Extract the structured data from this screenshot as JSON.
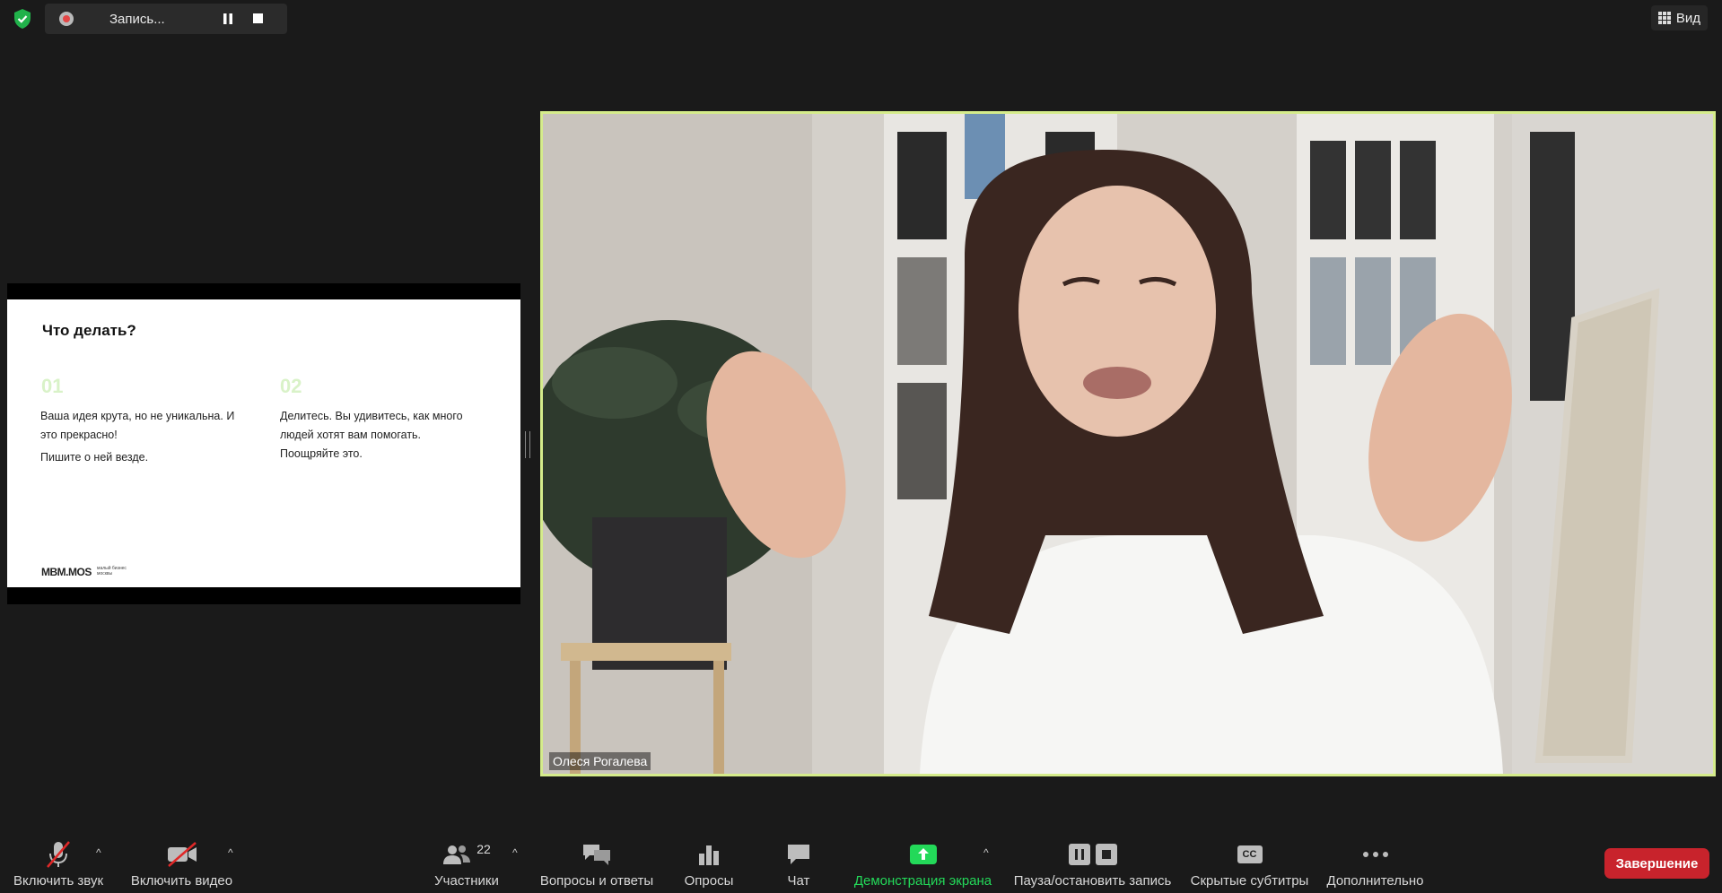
{
  "recording": {
    "label": "Запись..."
  },
  "view_button": {
    "label": "Вид"
  },
  "slide": {
    "title": "Что делать?",
    "col1": {
      "num": "01",
      "line1": "Ваша идея крута, но не уникальна. И",
      "line2": "это прекрасно!",
      "line3": "Пишите о ней везде."
    },
    "col2": {
      "num": "02",
      "line1": "Делитесь. Вы удивитесь, как много",
      "line2": "людей хотят вам помогать.",
      "line3": "Поощряйте это."
    },
    "brand": "MBM.MOS",
    "brand_sub_1": "малый бизнес",
    "brand_sub_2": "москвы"
  },
  "speaker": {
    "name": "Олеся Рогалева"
  },
  "toolbar": {
    "unmute": "Включить звук",
    "start_video": "Включить видео",
    "participants": "Участники",
    "participants_count": "22",
    "qa": "Вопросы и ответы",
    "polls": "Опросы",
    "chat": "Чат",
    "share": "Демонстрация экрана",
    "record": "Пауза/остановить запись",
    "captions": "Скрытые субтитры",
    "captions_icon_text": "CC",
    "more": "Дополнительно",
    "end": "Завершение"
  },
  "colors": {
    "active_speaker_border": "#d5ec8b",
    "share_green": "#23d959",
    "end_red": "#c8232c",
    "slide_accent": "#d9f2c8"
  }
}
